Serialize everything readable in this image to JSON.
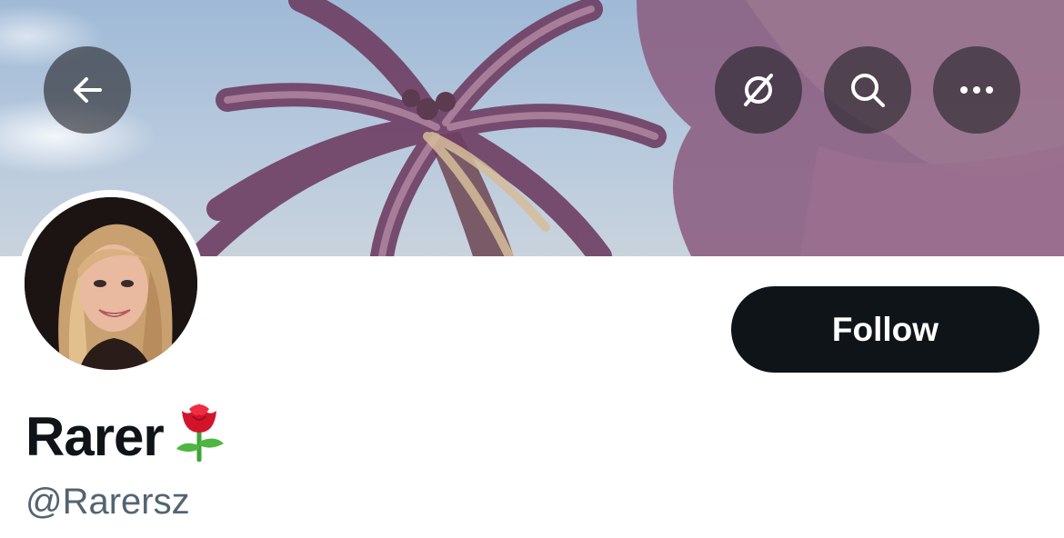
{
  "header": {
    "back_icon": "arrow-left-icon",
    "actions": [
      {
        "icon": "grok-icon"
      },
      {
        "icon": "search-icon"
      },
      {
        "icon": "more-horizontal-icon"
      }
    ]
  },
  "profile": {
    "display_name": "Rarer",
    "name_emoji": "rose-emoji",
    "handle": "@Rarersz",
    "follow_label": "Follow"
  },
  "colors": {
    "button_bg": "#0f1419",
    "text_primary": "#0f1419",
    "text_secondary": "#536471"
  }
}
